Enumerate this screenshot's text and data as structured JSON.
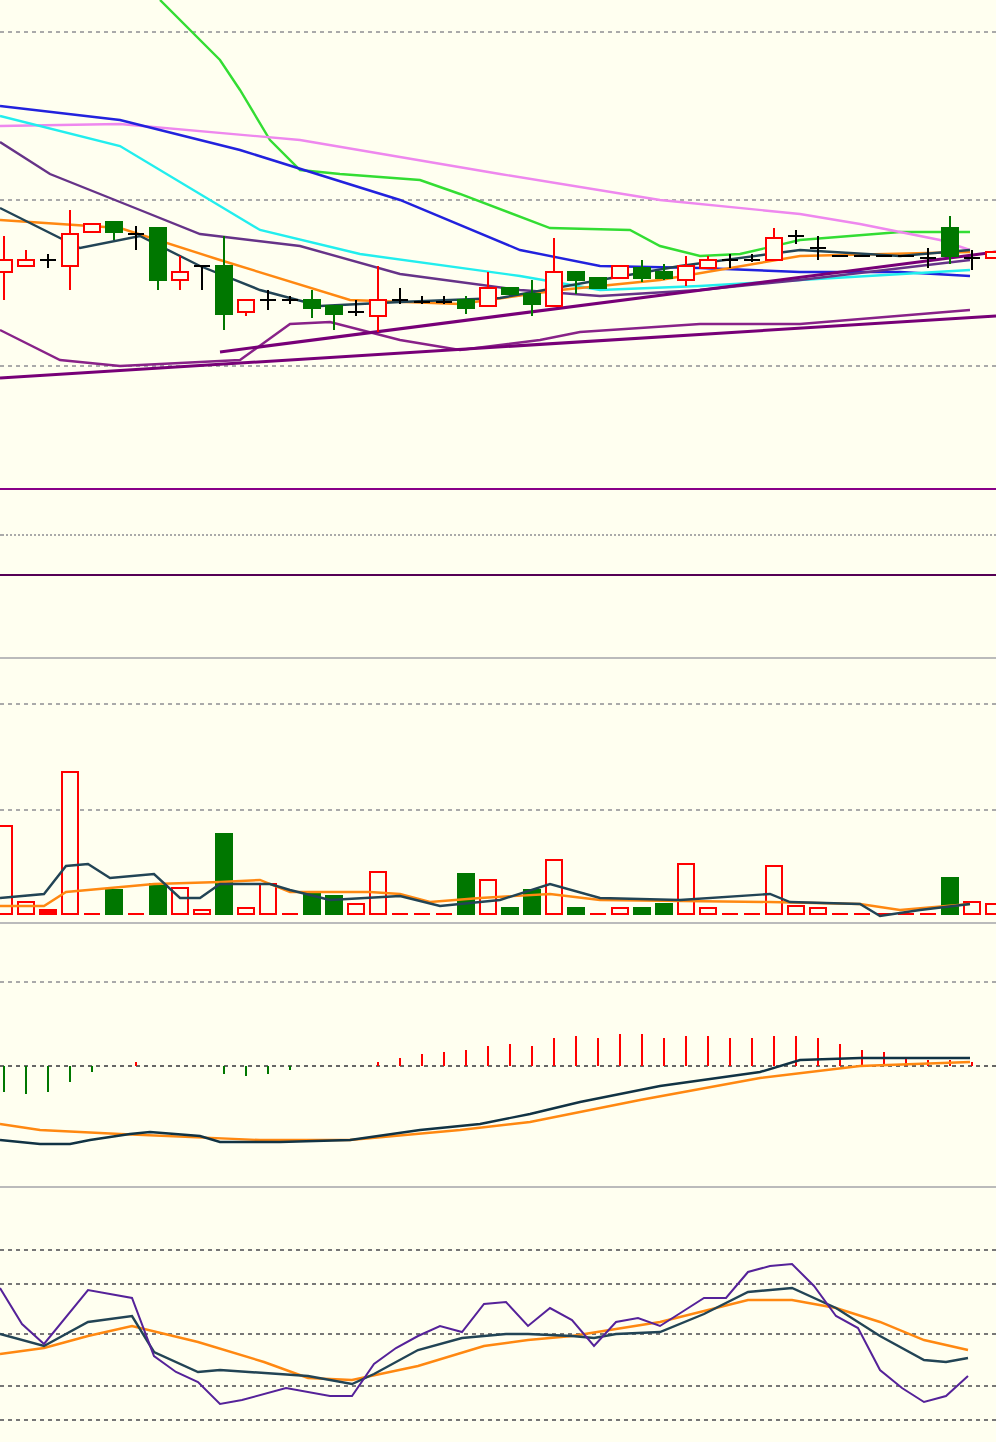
{
  "panels": [
    {
      "kind": "price"
    },
    {
      "kind": "blank"
    },
    {
      "kind": "volume"
    },
    {
      "kind": "macd"
    },
    {
      "kind": "oscillator"
    }
  ]
}
